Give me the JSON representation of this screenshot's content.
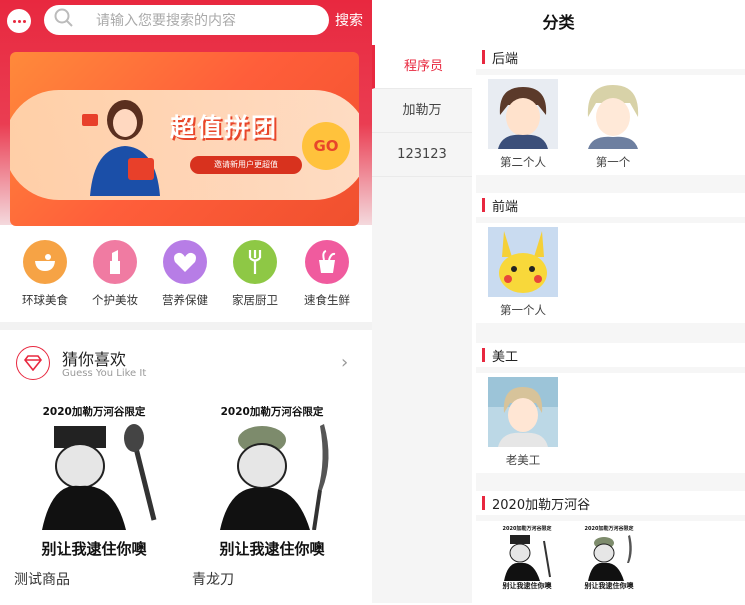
{
  "left": {
    "search": {
      "placeholder": "请输入您要搜索的内容",
      "button": "搜索"
    },
    "banner": {
      "title": "超值拼团",
      "subtitle": "邀请新用户更超值",
      "go": "GO"
    },
    "categories": [
      {
        "label": "环球美食",
        "color": "#f6a345"
      },
      {
        "label": "个护美妆",
        "color": "#f07ba2"
      },
      {
        "label": "营养保健",
        "color": "#b77de6"
      },
      {
        "label": "家居厨卫",
        "color": "#8ec845"
      },
      {
        "label": "速食生鲜",
        "color": "#f05b9e"
      }
    ],
    "guess": {
      "title": "猜你喜欢",
      "subtitle": "Guess You Like It"
    },
    "products": [
      {
        "name": "测试商品",
        "meme_top": "2020加勒万河谷限定",
        "meme_bottom": "别让我逮住你噢"
      },
      {
        "name": "青龙刀",
        "meme_top": "2020加勒万河谷限定",
        "meme_bottom": "别让我逮住你噢"
      }
    ]
  },
  "right": {
    "title": "分类",
    "sidebar": [
      "程序员",
      "加勒万",
      "123123"
    ],
    "sections": [
      {
        "title": "后端",
        "items": [
          "第二个人",
          "第一个"
        ]
      },
      {
        "title": "前端",
        "items": [
          "第一个人"
        ]
      },
      {
        "title": "美工",
        "items": [
          "老美工"
        ]
      },
      {
        "title": "2020加勒万河谷",
        "items": []
      }
    ],
    "meme": {
      "top": "2020加勒万河谷限定",
      "bottom": "别让我逮住你噢"
    }
  },
  "colors": {
    "accent": "#e8283f"
  }
}
